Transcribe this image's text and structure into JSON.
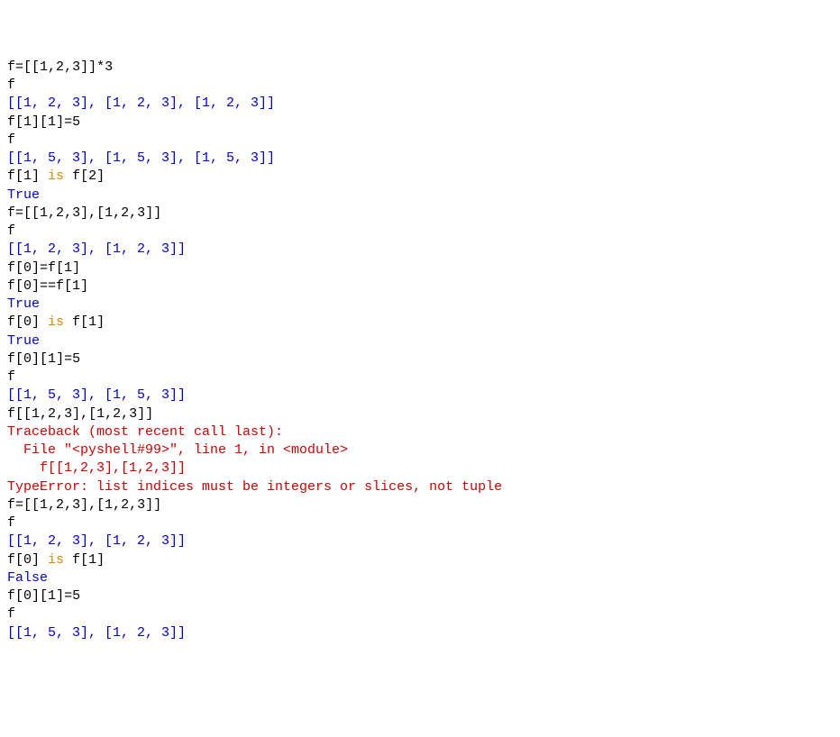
{
  "lines": [
    {
      "type": "input",
      "tokens": [
        {
          "t": "f=[[",
          "c": "black"
        },
        {
          "t": "1",
          "c": "black"
        },
        {
          "t": ",",
          "c": "black"
        },
        {
          "t": "2",
          "c": "black"
        },
        {
          "t": ",",
          "c": "black"
        },
        {
          "t": "3",
          "c": "black"
        },
        {
          "t": "]]*",
          "c": "black"
        },
        {
          "t": "3",
          "c": "black"
        }
      ]
    },
    {
      "type": "input",
      "tokens": [
        {
          "t": "f",
          "c": "black"
        }
      ]
    },
    {
      "type": "output",
      "tokens": [
        {
          "t": "[[1, 2, 3], [1, 2, 3], [1, 2, 3]]",
          "c": "blue"
        }
      ]
    },
    {
      "type": "input",
      "tokens": [
        {
          "t": "f[",
          "c": "black"
        },
        {
          "t": "1",
          "c": "black"
        },
        {
          "t": "][",
          "c": "black"
        },
        {
          "t": "1",
          "c": "black"
        },
        {
          "t": "]=",
          "c": "black"
        },
        {
          "t": "5",
          "c": "black"
        }
      ]
    },
    {
      "type": "input",
      "tokens": [
        {
          "t": "f",
          "c": "black"
        }
      ]
    },
    {
      "type": "output",
      "tokens": [
        {
          "t": "[[1, 5, 3], [1, 5, 3], [1, 5, 3]]",
          "c": "blue"
        }
      ]
    },
    {
      "type": "input",
      "tokens": [
        {
          "t": "f[",
          "c": "black"
        },
        {
          "t": "1",
          "c": "black"
        },
        {
          "t": "] ",
          "c": "black"
        },
        {
          "t": "is",
          "c": "orange"
        },
        {
          "t": " f[",
          "c": "black"
        },
        {
          "t": "2",
          "c": "black"
        },
        {
          "t": "]",
          "c": "black"
        }
      ]
    },
    {
      "type": "output",
      "tokens": [
        {
          "t": "True",
          "c": "blue"
        }
      ]
    },
    {
      "type": "input",
      "tokens": [
        {
          "t": "f=[[",
          "c": "black"
        },
        {
          "t": "1",
          "c": "black"
        },
        {
          "t": ",",
          "c": "black"
        },
        {
          "t": "2",
          "c": "black"
        },
        {
          "t": ",",
          "c": "black"
        },
        {
          "t": "3",
          "c": "black"
        },
        {
          "t": "],[",
          "c": "black"
        },
        {
          "t": "1",
          "c": "black"
        },
        {
          "t": ",",
          "c": "black"
        },
        {
          "t": "2",
          "c": "black"
        },
        {
          "t": ",",
          "c": "black"
        },
        {
          "t": "3",
          "c": "black"
        },
        {
          "t": "]]",
          "c": "black"
        }
      ]
    },
    {
      "type": "input",
      "tokens": [
        {
          "t": "f",
          "c": "black"
        }
      ]
    },
    {
      "type": "output",
      "tokens": [
        {
          "t": "[[1, 2, 3], [1, 2, 3]]",
          "c": "blue"
        }
      ]
    },
    {
      "type": "input",
      "tokens": [
        {
          "t": "f[",
          "c": "black"
        },
        {
          "t": "0",
          "c": "black"
        },
        {
          "t": "]=f[",
          "c": "black"
        },
        {
          "t": "1",
          "c": "black"
        },
        {
          "t": "]",
          "c": "black"
        }
      ]
    },
    {
      "type": "input",
      "tokens": [
        {
          "t": "f[",
          "c": "black"
        },
        {
          "t": "0",
          "c": "black"
        },
        {
          "t": "]==f[",
          "c": "black"
        },
        {
          "t": "1",
          "c": "black"
        },
        {
          "t": "]",
          "c": "black"
        }
      ]
    },
    {
      "type": "output",
      "tokens": [
        {
          "t": "True",
          "c": "blue"
        }
      ]
    },
    {
      "type": "input",
      "tokens": [
        {
          "t": "f[",
          "c": "black"
        },
        {
          "t": "0",
          "c": "black"
        },
        {
          "t": "] ",
          "c": "black"
        },
        {
          "t": "is",
          "c": "orange"
        },
        {
          "t": " f[",
          "c": "black"
        },
        {
          "t": "1",
          "c": "black"
        },
        {
          "t": "]",
          "c": "black"
        }
      ]
    },
    {
      "type": "output",
      "tokens": [
        {
          "t": "True",
          "c": "blue"
        }
      ]
    },
    {
      "type": "input",
      "tokens": [
        {
          "t": "f[",
          "c": "black"
        },
        {
          "t": "0",
          "c": "black"
        },
        {
          "t": "][",
          "c": "black"
        },
        {
          "t": "1",
          "c": "black"
        },
        {
          "t": "]=",
          "c": "black"
        },
        {
          "t": "5",
          "c": "black"
        }
      ]
    },
    {
      "type": "input",
      "tokens": [
        {
          "t": "f",
          "c": "black"
        }
      ]
    },
    {
      "type": "output",
      "tokens": [
        {
          "t": "[[1, 5, 3], [1, 5, 3]]",
          "c": "blue"
        }
      ]
    },
    {
      "type": "input",
      "tokens": [
        {
          "t": "f[[",
          "c": "black"
        },
        {
          "t": "1",
          "c": "black"
        },
        {
          "t": ",",
          "c": "black"
        },
        {
          "t": "2",
          "c": "black"
        },
        {
          "t": ",",
          "c": "black"
        },
        {
          "t": "3",
          "c": "black"
        },
        {
          "t": "],[",
          "c": "black"
        },
        {
          "t": "1",
          "c": "black"
        },
        {
          "t": ",",
          "c": "black"
        },
        {
          "t": "2",
          "c": "black"
        },
        {
          "t": ",",
          "c": "black"
        },
        {
          "t": "3",
          "c": "black"
        },
        {
          "t": "]]",
          "c": "black"
        }
      ]
    },
    {
      "type": "error",
      "tokens": [
        {
          "t": "Traceback (most recent call last):",
          "c": "red"
        }
      ]
    },
    {
      "type": "error",
      "tokens": [
        {
          "t": "  File \"<pyshell#99>\", line 1, in <module>",
          "c": "red"
        }
      ]
    },
    {
      "type": "error",
      "tokens": [
        {
          "t": "    f[[1,2,3],[1,2,3]]",
          "c": "red"
        }
      ]
    },
    {
      "type": "error",
      "tokens": [
        {
          "t": "TypeError: list indices must be integers or slices, not tuple",
          "c": "red"
        }
      ]
    },
    {
      "type": "input",
      "tokens": [
        {
          "t": "f=[[",
          "c": "black"
        },
        {
          "t": "1",
          "c": "black"
        },
        {
          "t": ",",
          "c": "black"
        },
        {
          "t": "2",
          "c": "black"
        },
        {
          "t": ",",
          "c": "black"
        },
        {
          "t": "3",
          "c": "black"
        },
        {
          "t": "],[",
          "c": "black"
        },
        {
          "t": "1",
          "c": "black"
        },
        {
          "t": ",",
          "c": "black"
        },
        {
          "t": "2",
          "c": "black"
        },
        {
          "t": ",",
          "c": "black"
        },
        {
          "t": "3",
          "c": "black"
        },
        {
          "t": "]]",
          "c": "black"
        }
      ]
    },
    {
      "type": "input",
      "tokens": [
        {
          "t": "f",
          "c": "black"
        }
      ]
    },
    {
      "type": "output",
      "tokens": [
        {
          "t": "[[1, 2, 3], [1, 2, 3]]",
          "c": "blue"
        }
      ]
    },
    {
      "type": "input",
      "tokens": [
        {
          "t": "f[",
          "c": "black"
        },
        {
          "t": "0",
          "c": "black"
        },
        {
          "t": "] ",
          "c": "black"
        },
        {
          "t": "is",
          "c": "orange"
        },
        {
          "t": " f[",
          "c": "black"
        },
        {
          "t": "1",
          "c": "black"
        },
        {
          "t": "]",
          "c": "black"
        }
      ]
    },
    {
      "type": "output",
      "tokens": [
        {
          "t": "False",
          "c": "blue"
        }
      ]
    },
    {
      "type": "input",
      "tokens": [
        {
          "t": "f[",
          "c": "black"
        },
        {
          "t": "0",
          "c": "black"
        },
        {
          "t": "][",
          "c": "black"
        },
        {
          "t": "1",
          "c": "black"
        },
        {
          "t": "]=",
          "c": "black"
        },
        {
          "t": "5",
          "c": "black"
        }
      ]
    },
    {
      "type": "input",
      "tokens": [
        {
          "t": "f",
          "c": "black"
        }
      ]
    },
    {
      "type": "output",
      "tokens": [
        {
          "t": "[[1, 5, 3], [1, 2, 3]]",
          "c": "blue"
        }
      ]
    }
  ]
}
